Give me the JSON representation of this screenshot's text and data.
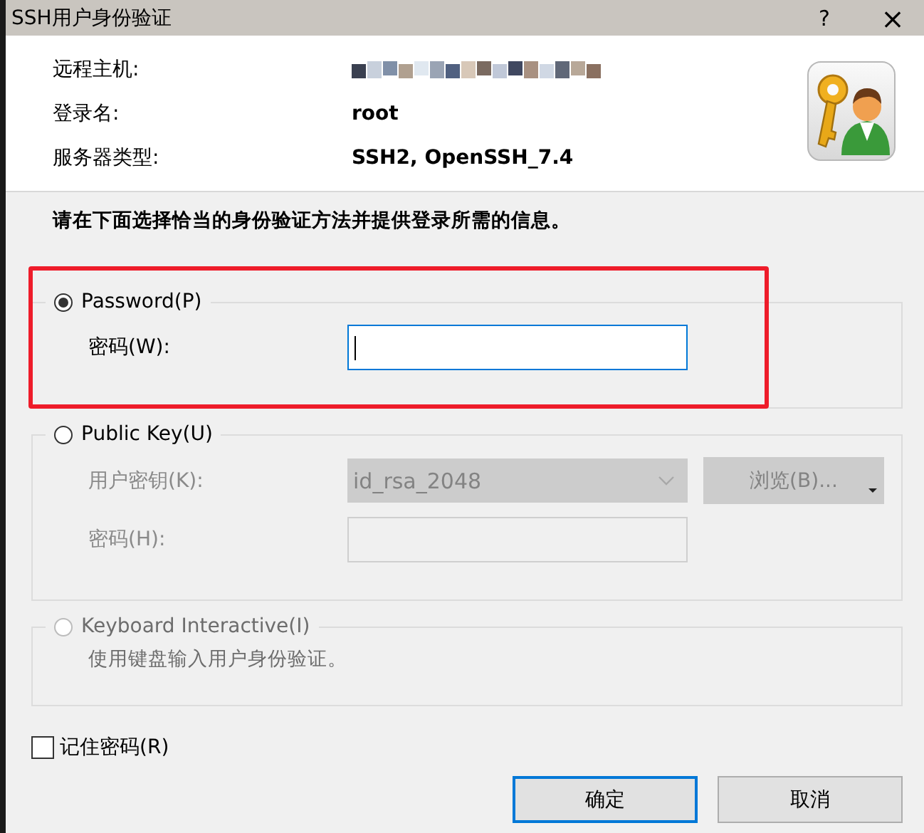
{
  "window": {
    "title": "SSH用户身份验证",
    "help_button": "?",
    "close_button": "×"
  },
  "info": [
    {
      "kind": "redacted",
      "label": "远程主机:"
    },
    {
      "kind": "text",
      "label": "登录名:",
      "value": "root"
    },
    {
      "kind": "text",
      "label": "服务器类型:",
      "value": "SSH2, OpenSSH_7.4"
    }
  ],
  "instruction": "请在下面选择恰当的身份验证方法并提供登录所需的信息。",
  "methods": [
    {
      "label": "Password(P)",
      "selected": true,
      "disabled": false,
      "highlighted": true,
      "fields": [
        {
          "kind": "input",
          "label": "密码(W):",
          "disabled": false,
          "focused": true
        }
      ]
    },
    {
      "label": "Public Key(U)",
      "selected": false,
      "disabled": false,
      "highlighted": false,
      "fields": [
        {
          "kind": "select",
          "label": "用户密钥(K):",
          "value": "id_rsa_2048",
          "disabled": true,
          "button": "浏览(B)..."
        },
        {
          "kind": "input",
          "label": "密码(H):",
          "disabled": true,
          "focused": false
        }
      ]
    },
    {
      "label": "Keyboard Interactive(I)",
      "selected": false,
      "disabled": true,
      "highlighted": false,
      "description": "使用键盘输入用户身份验证。"
    }
  ],
  "remember": {
    "label": "记住密码(R)",
    "checked": false
  },
  "buttons": [
    {
      "label": "确定",
      "default": true
    },
    {
      "label": "取消",
      "default": false
    }
  ]
}
